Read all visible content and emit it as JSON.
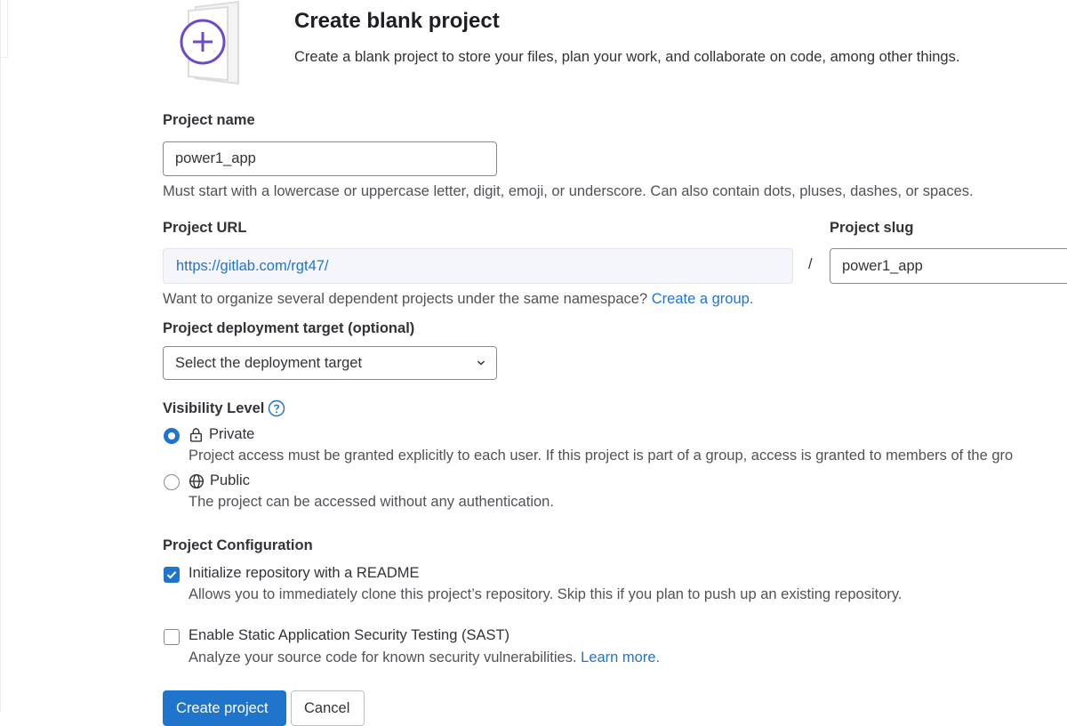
{
  "header": {
    "title": "Create blank project",
    "subtitle": "Create a blank project to store your files, plan your work, and collaborate on code, among other things."
  },
  "project_name": {
    "label": "Project name",
    "value": "power1_app",
    "help": "Must start with a lowercase or uppercase letter, digit, emoji, or underscore. Can also contain dots, pluses, dashes, or spaces."
  },
  "project_url": {
    "label": "Project URL",
    "prefix": "https://gitlab.com/rgt47/",
    "separator": "/",
    "help_text": "Want to organize several dependent projects under the same namespace?",
    "help_link": "Create a group."
  },
  "project_slug": {
    "label": "Project slug",
    "value": "power1_app"
  },
  "deployment": {
    "label": "Project deployment target (optional)",
    "selected": "Select the deployment target"
  },
  "visibility": {
    "label": "Visibility Level",
    "options": [
      {
        "label": "Private",
        "icon": "lock-icon",
        "checked": true,
        "description": "Project access must be granted explicitly to each user. If this project is part of a group, access is granted to members of the gro"
      },
      {
        "label": "Public",
        "icon": "globe-icon",
        "checked": false,
        "description": "The project can be accessed without any authentication."
      }
    ]
  },
  "configuration": {
    "label": "Project Configuration",
    "options": [
      {
        "label": "Initialize repository with a README",
        "checked": true,
        "description": "Allows you to immediately clone this project’s repository. Skip this if you plan to push up an existing repository."
      },
      {
        "label": "Enable Static Application Security Testing (SAST)",
        "checked": false,
        "description": "Analyze your source code for known security vulnerabilities.",
        "link": "Learn more."
      }
    ]
  },
  "actions": {
    "create": "Create project",
    "cancel": "Cancel"
  },
  "colors": {
    "accent": "#1f75cb",
    "illustration": "#6e49cb"
  }
}
